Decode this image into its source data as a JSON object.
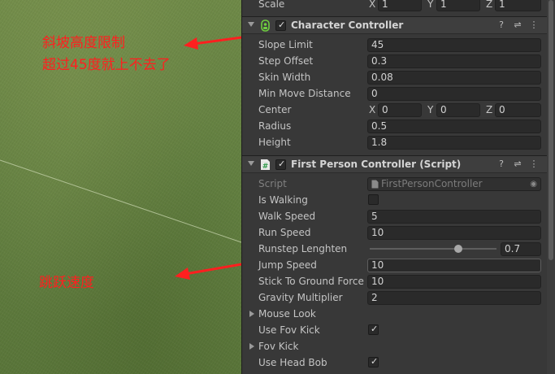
{
  "annotations": {
    "slope_line1": "斜坡高度限制",
    "slope_line2": "超过45度就上不去了",
    "jump": "跳跃速度"
  },
  "transform_scale": {
    "label": "Scale",
    "x": "1",
    "y": "1",
    "z": "1"
  },
  "character_controller": {
    "title": "Character Controller",
    "enabled": true,
    "fields": [
      {
        "label": "Slope Limit",
        "value": "45"
      },
      {
        "label": "Step Offset",
        "value": "0.3"
      },
      {
        "label": "Skin Width",
        "value": "0.08"
      },
      {
        "label": "Min Move Distance",
        "value": "0"
      }
    ],
    "center": {
      "label": "Center",
      "x": "0",
      "y": "0",
      "z": "0"
    },
    "radius": {
      "label": "Radius",
      "value": "0.5"
    },
    "height": {
      "label": "Height",
      "value": "1.8"
    }
  },
  "first_person_controller": {
    "title": "First Person Controller (Script)",
    "enabled": true,
    "script": {
      "label": "Script",
      "value": "FirstPersonController"
    },
    "is_walking": {
      "label": "Is Walking",
      "checked": false
    },
    "walk_speed": {
      "label": "Walk Speed",
      "value": "5"
    },
    "run_speed": {
      "label": "Run Speed",
      "value": "10"
    },
    "runstep": {
      "label": "Runstep Lenghten",
      "value": "0.7",
      "fraction": 0.7
    },
    "jump_speed": {
      "label": "Jump Speed",
      "value": "10"
    },
    "stick_to_ground": {
      "label": "Stick To Ground Force",
      "value": "10"
    },
    "gravity": {
      "label": "Gravity Multiplier",
      "value": "2"
    },
    "mouse_look": {
      "label": "Mouse Look"
    },
    "use_fov_kick": {
      "label": "Use Fov Kick",
      "checked": true
    },
    "fov_kick": {
      "label": "Fov Kick"
    },
    "use_head_bob": {
      "label": "Use Head Bob",
      "checked": true
    }
  },
  "colors": {
    "annotation": "#ff1f1f",
    "inspector_bg": "#383838",
    "field_bg": "#2a2a2a"
  },
  "icons": [
    "help-icon",
    "preset-icon",
    "kebab-menu-icon",
    "character-controller-icon",
    "script-hash-icon",
    "script-file-icon",
    "object-picker-icon",
    "checkmark-icon",
    "foldout-arrow-icon"
  ]
}
